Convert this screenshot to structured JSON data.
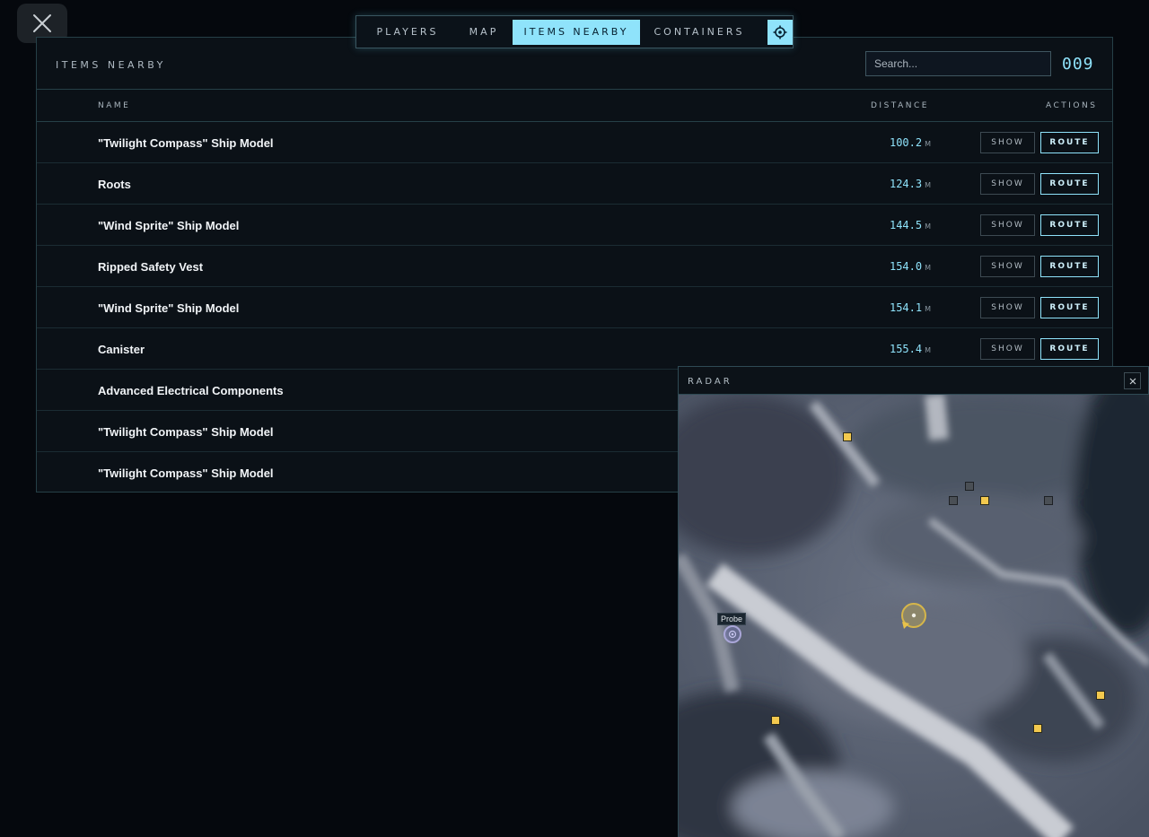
{
  "tabs": [
    {
      "label": "PLAYERS",
      "active": false
    },
    {
      "label": "MAP",
      "active": false
    },
    {
      "label": "ITEMS NEARBY",
      "active": true
    },
    {
      "label": "CONTAINERS",
      "active": false
    }
  ],
  "panel": {
    "title": "ITEMS NEARBY",
    "search_placeholder": "Search...",
    "count": "009"
  },
  "columns": {
    "name": "NAME",
    "distance": "DISTANCE",
    "actions": "ACTIONS"
  },
  "items": [
    {
      "name": "\"Twilight Compass\" Ship Model",
      "distance": "100.2",
      "unit": "M"
    },
    {
      "name": "Roots",
      "distance": "124.3",
      "unit": "M"
    },
    {
      "name": "\"Wind Sprite\" Ship Model",
      "distance": "144.5",
      "unit": "M"
    },
    {
      "name": "Ripped Safety Vest",
      "distance": "154.0",
      "unit": "M"
    },
    {
      "name": "\"Wind Sprite\" Ship Model",
      "distance": "154.1",
      "unit": "M"
    },
    {
      "name": "Canister",
      "distance": "155.4",
      "unit": "M"
    },
    {
      "name": "Advanced Electrical Components",
      "distance": "",
      "unit": ""
    },
    {
      "name": "\"Twilight Compass\" Ship Model",
      "distance": "",
      "unit": ""
    },
    {
      "name": "\"Twilight Compass\" Ship Model",
      "distance": "",
      "unit": ""
    }
  ],
  "actions": {
    "show": "SHOW",
    "route": "ROUTE"
  },
  "radar": {
    "title": "RADAR",
    "probe_label": "Probe"
  },
  "colors": {
    "accent": "#8fe3fb",
    "loot_marker": "#f3c94e",
    "empty_marker": "#4a4f55",
    "player_marker": "#d6b64a",
    "probe_marker": "#a9a6d8"
  }
}
